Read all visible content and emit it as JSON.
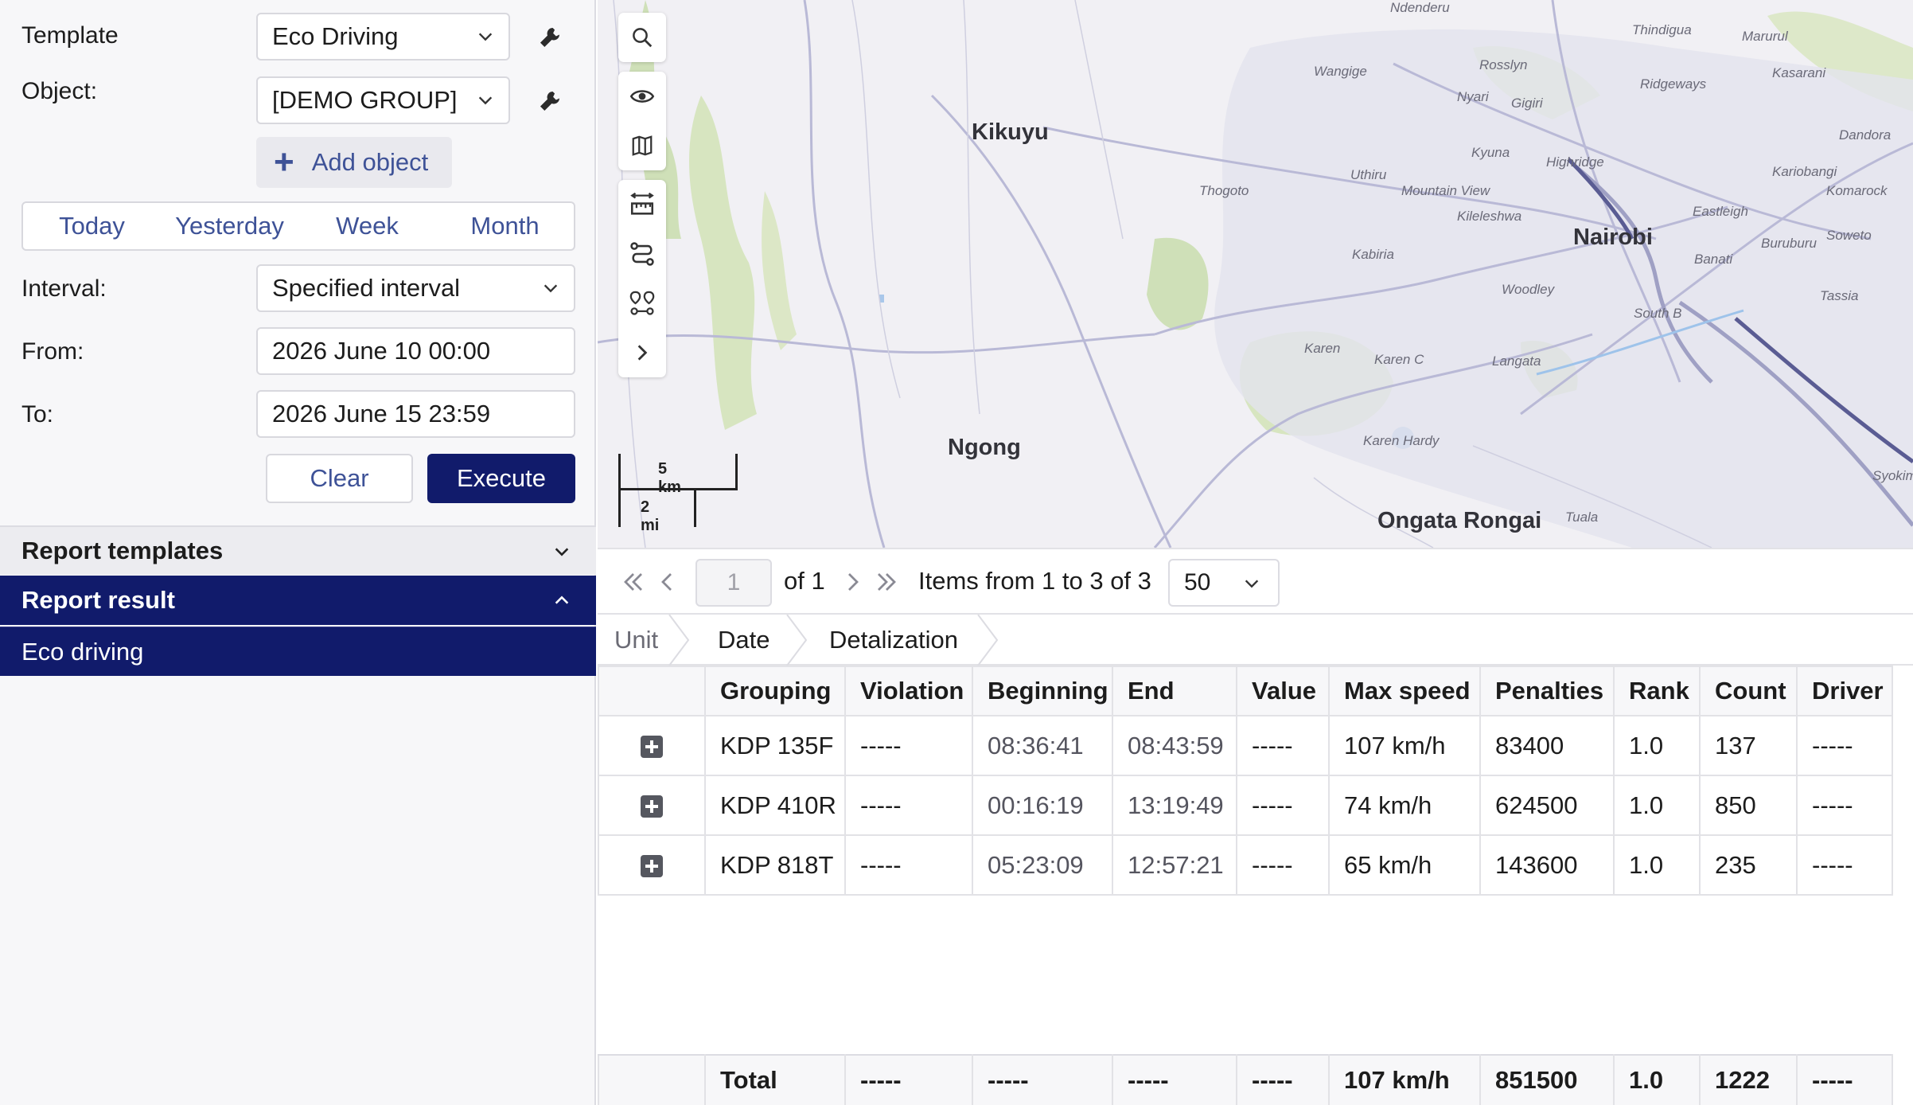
{
  "form": {
    "template_label": "Template",
    "template_value": "Eco Driving",
    "object_label": "Object:",
    "object_value": "[DEMO GROUP]",
    "add_object": "Add object",
    "periods": [
      "Today",
      "Yesterday",
      "Week",
      "Month"
    ],
    "interval_label": "Interval:",
    "interval_value": "Specified interval",
    "from_label": "From:",
    "from_value": "2026 June 10 00:00",
    "to_label": "To:",
    "to_value": "2026 June 15 23:59",
    "clear": "Clear",
    "execute": "Execute"
  },
  "accordion": {
    "templates": "Report templates",
    "result": "Report result",
    "result_item": "Eco driving"
  },
  "map": {
    "places": {
      "kikuyu": "Kikuyu",
      "nairobi": "Nairobi",
      "ngong": "Ngong",
      "ongata": "Ongata Rongai",
      "ndenderu": "Ndenderu",
      "thindigua": "Thindigua",
      "marurul": "Marurul",
      "wangige": "Wangige",
      "rosslyn": "Rosslyn",
      "ridgeways": "Ridgeways",
      "kasarani": "Kasarani",
      "nyari": "Nyari",
      "gigiri": "Gigiri",
      "dandora": "Dandora",
      "kyuna": "Kyuna",
      "highridge": "Highridge",
      "uthiru": "Uthiru",
      "mountainview": "Mountain View",
      "kariobangi": "Kariobangi",
      "thogoto": "Thogoto",
      "komarock": "Komarock",
      "kileleshwa": "Kileleshwa",
      "eastleigh": "Eastleigh",
      "kabiria": "Kabiria",
      "soweto": "Soweto",
      "woodley": "Woodley",
      "banati": "Banati",
      "buruburu": "Buruburu",
      "tassia": "Tassia",
      "karen": "Karen",
      "karenc": "Karen C",
      "langata": "Langata",
      "southb": "South B",
      "karenhardy": "Karen Hardy",
      "tuala": "Tuala",
      "syokimau": "Syokimau"
    },
    "scale_km": "5 km",
    "scale_mi": "2 mi",
    "toolbar_icons": [
      "search-icon",
      "eye-icon",
      "map-icon",
      "ruler-icon",
      "route-icon",
      "waypoints-icon",
      "chevron-right-icon"
    ]
  },
  "pager": {
    "page": "1",
    "of": "of 1",
    "items": "Items from 1 to 3 of 3",
    "per_page": "50"
  },
  "grouping": [
    "Unit",
    "Date",
    "Detalization"
  ],
  "table": {
    "columns": [
      "Grouping",
      "Violation",
      "Beginning",
      "End",
      "Value",
      "Max speed",
      "Penalties",
      "Rank",
      "Count",
      "Driver"
    ],
    "rows": [
      [
        "KDP 135F",
        "-----",
        "08:36:41",
        "08:43:59",
        "-----",
        "107 km/h",
        "83400",
        "1.0",
        "137",
        "-----"
      ],
      [
        "KDP 410R",
        "-----",
        "00:16:19",
        "13:19:49",
        "-----",
        "74 km/h",
        "624500",
        "1.0",
        "850",
        "-----"
      ],
      [
        "KDP 818T",
        "-----",
        "05:23:09",
        "12:57:21",
        "-----",
        "65 km/h",
        "143600",
        "1.0",
        "235",
        "-----"
      ]
    ],
    "total": [
      "Total",
      "-----",
      "-----",
      "-----",
      "-----",
      "107 km/h",
      "851500",
      "1.0",
      "1222",
      "-----"
    ]
  },
  "colors": {
    "accent": "#111b6b",
    "link": "#3e5297",
    "panel_bg": "#f7f7f9"
  }
}
